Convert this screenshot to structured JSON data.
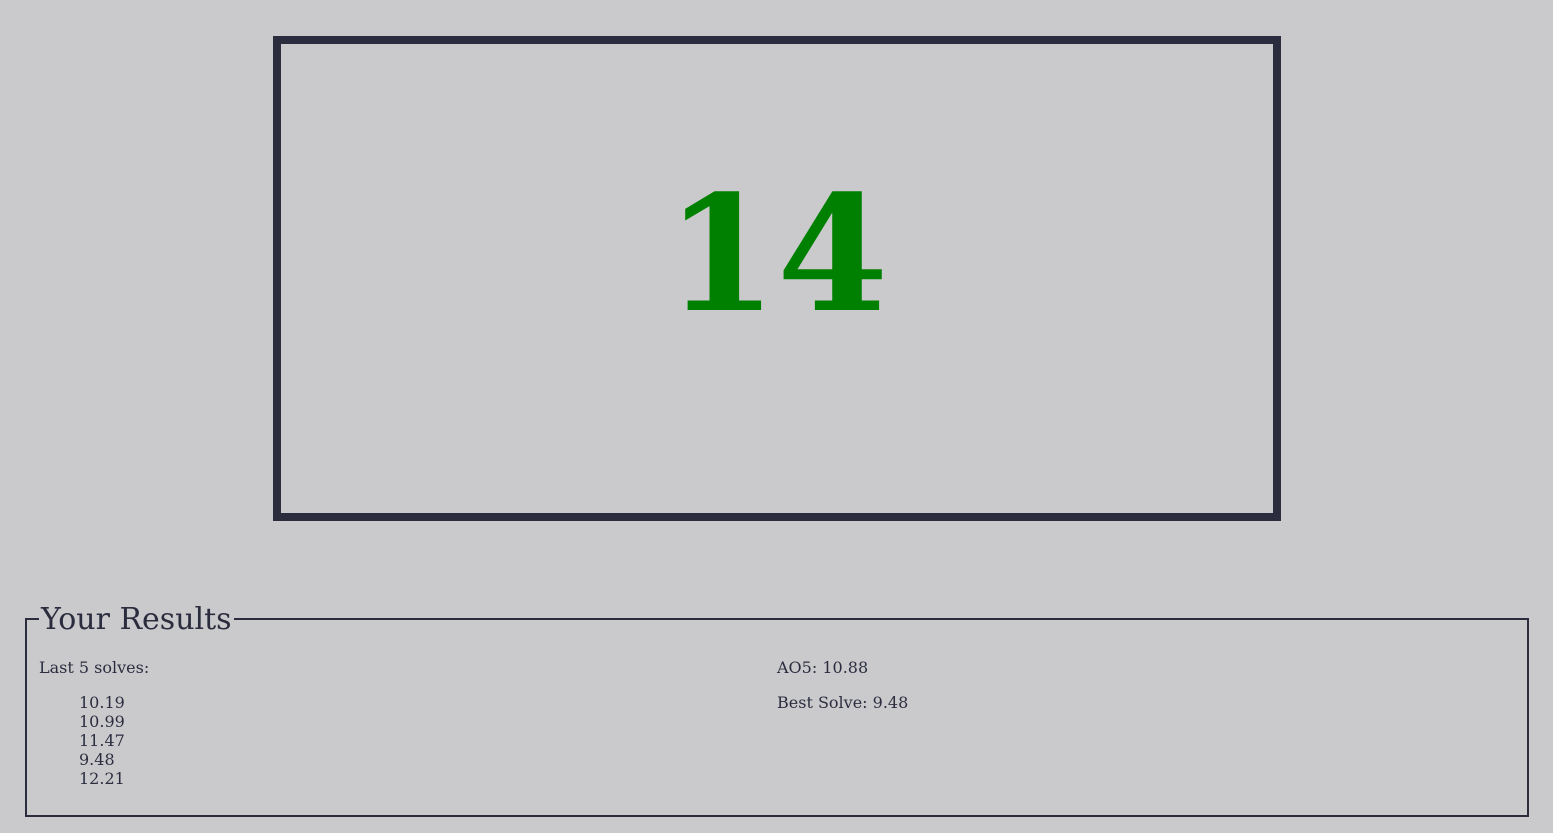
{
  "timer": {
    "value": "14",
    "color": "#008000"
  },
  "results": {
    "legend": "Your Results",
    "last_solves_label": "Last 5 solves:",
    "solves": [
      "10.19",
      "10.99",
      "11.47",
      "9.48",
      "12.21"
    ],
    "ao5": "AO5: 10.88",
    "best_solve": "Best Solve: 9.48"
  },
  "colors": {
    "background": "#cacacc",
    "border": "#2b2d3f",
    "timer_text": "#008000"
  }
}
